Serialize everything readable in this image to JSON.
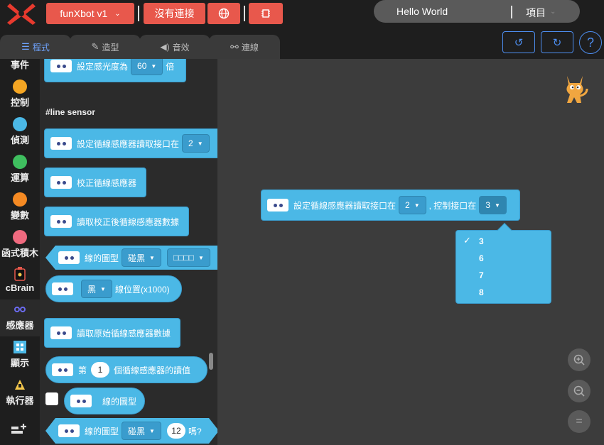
{
  "menubar": {
    "device_label": "funXbot v1",
    "connect_label": "沒有連接",
    "project_title": "Hello World",
    "project_menu": "項目"
  },
  "tabs": {
    "code": "程式",
    "costume": "造型",
    "sound": "音效",
    "connect": "連線"
  },
  "toolbar": {
    "help": "?"
  },
  "categories": [
    {
      "label": "事件",
      "color": "#f5c84c"
    },
    {
      "label": "控制",
      "color": "#f5a623"
    },
    {
      "label": "偵測",
      "color": "#4bb8e6"
    },
    {
      "label": "運算",
      "color": "#3fbf5f"
    },
    {
      "label": "變數",
      "color": "#f58a23"
    },
    {
      "label": "函式積木",
      "color": "#f06a7f"
    },
    {
      "label": "cBrain",
      "color": "#e8584c"
    },
    {
      "label": "感應器",
      "color": "#6b6bf0"
    },
    {
      "label": "顯示",
      "color": "#4bb8e6"
    },
    {
      "label": "執行器",
      "color": "#f5c84c"
    }
  ],
  "palette": {
    "light_block": {
      "text": "設定感光度為",
      "value": "60",
      "suffix": "倍"
    },
    "section": "#line sensor",
    "read_port": {
      "text": "設定循線感應器讀取接口在",
      "value": "2"
    },
    "calibrate": "校正循線感應器",
    "read_calibrated": "讀取校正後循線感應器數據",
    "line_pattern": {
      "text": "線的圖型",
      "value1": "碰黑",
      "value2": "□□□□"
    },
    "line_position": {
      "value": "黑",
      "text": "線位置(x1000)"
    },
    "read_raw": "讀取原始循線感應器數據",
    "nth_sensor": {
      "prefix": "第",
      "value": "1",
      "suffix": "個循線感應器的讀值"
    },
    "pattern_reporter": "線的圖型",
    "pattern_bool": {
      "text": "線的圖型",
      "value1": "碰黑",
      "value2": "12",
      "suffix": "嗎?"
    }
  },
  "workspace": {
    "block": {
      "text1": "設定循線感應器讀取接口在",
      "value1": "2",
      "text2": ", 控制接口在",
      "value2": "3"
    },
    "dropdown": {
      "options": [
        "3",
        "6",
        "7",
        "8"
      ],
      "selected": "3"
    },
    "zoom_in": "+",
    "zoom_out": "−",
    "zoom_reset": "="
  }
}
